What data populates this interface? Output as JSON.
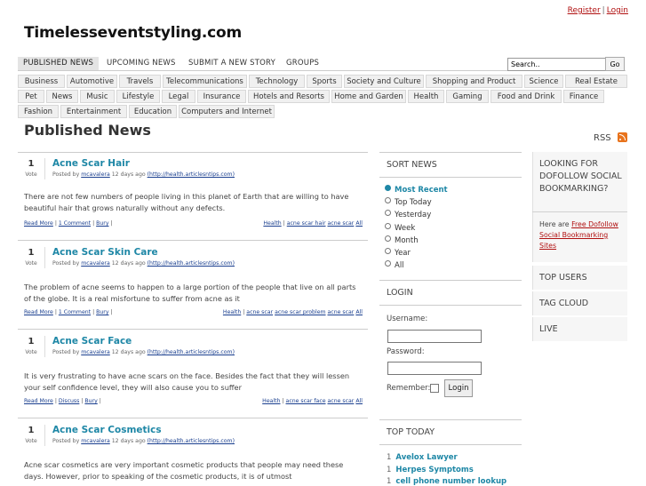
{
  "top_links": {
    "register": "Register",
    "separator": "|",
    "login": "Login"
  },
  "site_title": "Timelesseventstyling.com",
  "main_nav": [
    {
      "label": "Published News",
      "active": true
    },
    {
      "label": "Upcoming News",
      "active": false
    },
    {
      "label": "Submit a New Story",
      "active": false
    },
    {
      "label": "Groups",
      "active": false
    }
  ],
  "search": {
    "value": "Search..",
    "button": "Go"
  },
  "categories": [
    [
      "Business",
      "Automotive",
      "Travels",
      "Telecommunications",
      "Technology",
      "Sports",
      "Society and Culture",
      "Shopping and Product",
      "Science",
      "Real Estate"
    ],
    [
      "Pet",
      "News",
      "Music",
      "Lifestyle",
      "Legal",
      "Insurance",
      "Hotels and Resorts",
      "Home and Garden",
      "Health",
      "Gaming",
      "Food and Drink",
      "Finance"
    ],
    [
      "Fashion",
      "Entertainment",
      "Education",
      "Computers and Internet"
    ]
  ],
  "page_title": "Published News",
  "rss_label": "RSS",
  "stories": [
    {
      "votes": "1",
      "vote_label": "Vote",
      "title": "Acne Scar Hair",
      "meta_prefix": "Posted by",
      "author": "mcavalera",
      "age": "12 days ago",
      "url": "(http://health.articlesntips.com)",
      "body": "There are not few numbers of people living in this planet of Earth that are willing to have beautiful hair that grows naturally without any defects.",
      "actions": [
        "Read More",
        "1 Comment",
        "Bury"
      ],
      "category": "Health",
      "tags": [
        "acne scar hair",
        "acne scar",
        "All"
      ]
    },
    {
      "votes": "1",
      "vote_label": "Vote",
      "title": "Acne Scar Skin Care",
      "meta_prefix": "Posted by",
      "author": "mcavalera",
      "age": "12 days ago",
      "url": "(http://health.articlesntips.com)",
      "body": "The problem of acne seems to happen to a large portion of the people that live on all parts of the globe. It is a real misfortune to suffer from acne as it",
      "actions": [
        "Read More",
        "1 Comment",
        "Bury"
      ],
      "category": "Health",
      "tags": [
        "acne scar",
        "acne scar problem",
        "acne scar",
        "All"
      ]
    },
    {
      "votes": "1",
      "vote_label": "Vote",
      "title": "Acne Scar Face",
      "meta_prefix": "Posted by",
      "author": "mcavalera",
      "age": "12 days ago",
      "url": "(http://health.articlesntips.com)",
      "body": "It is very frustrating to have acne scars on the face. Besides the fact that they will lessen your self confidence level, they will also cause you to suffer",
      "actions": [
        "Read More",
        "Discuss",
        "Bury"
      ],
      "category": "Health",
      "tags": [
        "acne scar face",
        "acne scar",
        "All"
      ]
    },
    {
      "votes": "1",
      "vote_label": "Vote",
      "title": "Acne Scar Cosmetics",
      "meta_prefix": "Posted by",
      "author": "mcavalera",
      "age": "12 days ago",
      "url": "(http://health.articlesntips.com)",
      "body": "Acne scar cosmetics are very important cosmetic products that people may need these days. However, prior to speaking of the cosmetic products, it is of utmost",
      "actions": [],
      "category": "",
      "tags": []
    }
  ],
  "sort_news": {
    "header": "Sort News",
    "options": [
      {
        "label": "Most Recent",
        "active": true
      },
      {
        "label": "Top Today",
        "active": false
      },
      {
        "label": "Yesterday",
        "active": false
      },
      {
        "label": "Week",
        "active": false
      },
      {
        "label": "Month",
        "active": false
      },
      {
        "label": "Year",
        "active": false
      },
      {
        "label": "All",
        "active": false
      }
    ]
  },
  "login_box": {
    "header": "Login",
    "username_label": "Username:",
    "password_label": "Password:",
    "remember_label": "Remember:",
    "button": "Login"
  },
  "top_today": {
    "header": "Top Today",
    "items": [
      {
        "n": "1",
        "title": "Avelox Lawyer"
      },
      {
        "n": "1",
        "title": "Herpes Symptoms"
      },
      {
        "n": "1",
        "title": "cell phone number lookup"
      }
    ]
  },
  "right_sidebar": {
    "dofollow_header": "Looking for Dofollow Social Bookmarking?",
    "here_are": "Here are",
    "link": "Free Dofollow Social Bookmarking Sites",
    "sections": [
      "Top Users",
      "Tag Cloud",
      "Live"
    ]
  }
}
